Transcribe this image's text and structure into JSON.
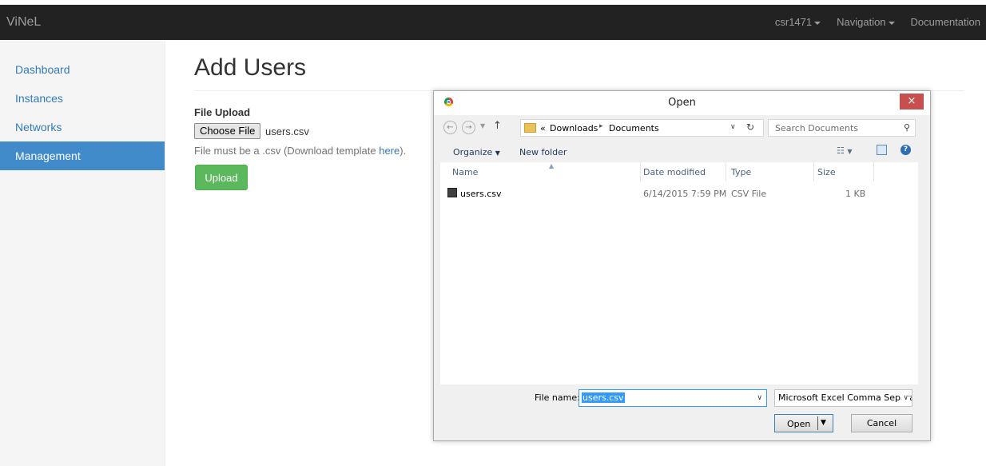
{
  "navbar": {
    "brand": "ViNeL",
    "user": "csr1471",
    "navigation": "Navigation",
    "documentation": "Documentation"
  },
  "sidebar": {
    "items": [
      {
        "label": "Dashboard",
        "active": false
      },
      {
        "label": "Instances",
        "active": false
      },
      {
        "label": "Networks",
        "active": false
      },
      {
        "label": "Management",
        "active": true
      }
    ]
  },
  "main": {
    "title": "Add Users",
    "upload_label": "File Upload",
    "choose_file_label": "Choose File",
    "chosen_file": "users.csv",
    "help_prefix": "File must be a .csv (Download template ",
    "help_link": "here",
    "help_suffix": ").",
    "upload_button": "Upload"
  },
  "dialog": {
    "title": "Open",
    "close_glyph": "×",
    "path_prefix": "«",
    "path": [
      "Downloads",
      "Documents"
    ],
    "search_placeholder": "Search Documents",
    "organize_label": "Organize",
    "new_folder_label": "New folder",
    "columns": {
      "name": "Name",
      "date": "Date modified",
      "type": "Type",
      "size": "Size"
    },
    "files": [
      {
        "name": "users.csv",
        "date": "6/14/2015 7:59 PM",
        "type": "CSV File",
        "size": "1 KB"
      }
    ],
    "file_name_label": "File name:",
    "file_name_value": "users.csv",
    "file_type_value": "Microsoft Excel Comma Separa",
    "open_label": "Open",
    "cancel_label": "Cancel"
  },
  "colors": {
    "navbar_bg": "#222222",
    "sidebar_active": "#428bca",
    "link": "#337ab7",
    "upload_green": "#5cb85c",
    "dialog_close_red": "#c7504f"
  }
}
